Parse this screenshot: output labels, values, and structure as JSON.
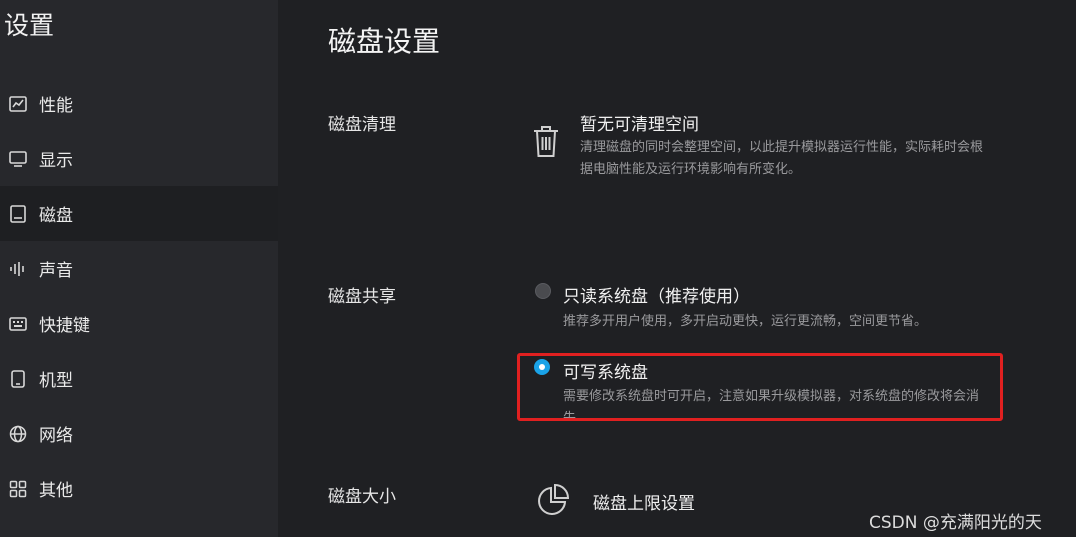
{
  "sidebar": {
    "title": "设置",
    "items": [
      {
        "label": "性能",
        "icon": "performance-chart-icon"
      },
      {
        "label": "显示",
        "icon": "monitor-icon"
      },
      {
        "label": "磁盘",
        "icon": "disk-icon",
        "active": true
      },
      {
        "label": "声音",
        "icon": "sound-wave-icon"
      },
      {
        "label": "快捷键",
        "icon": "keyboard-icon"
      },
      {
        "label": "机型",
        "icon": "phone-icon"
      },
      {
        "label": "网络",
        "icon": "globe-icon"
      },
      {
        "label": "其他",
        "icon": "grid-icon"
      }
    ]
  },
  "main": {
    "title": "磁盘设置",
    "cleanup": {
      "label": "磁盘清理",
      "title": "暂无可清理空间",
      "desc_line1": "清理磁盘的同时会整理空间，以此提升模拟器运行性能，实际耗时会根",
      "desc_line2": "据电脑性能及运行环境影响有所变化。"
    },
    "share": {
      "label": "磁盘共享",
      "options": [
        {
          "title": "只读系统盘（推荐使用）",
          "desc": "推荐多开用户使用，多开启动更快，运行更流畅，空间更节省。",
          "selected": false
        },
        {
          "title": "可写系统盘",
          "desc_line1": "需要修改系统盘时可开启，注意如果升级模拟器，对系统盘的修改将会消",
          "desc_line2": "失。",
          "selected": true
        }
      ]
    },
    "size": {
      "label": "磁盘大小",
      "limit_label": "磁盘上限设置"
    }
  },
  "watermark": "CSDN @充满阳光的天",
  "colors": {
    "accent": "#1aa3e8",
    "highlight": "#e02020",
    "background": "#1f2023",
    "sidebar": "#27282c"
  }
}
